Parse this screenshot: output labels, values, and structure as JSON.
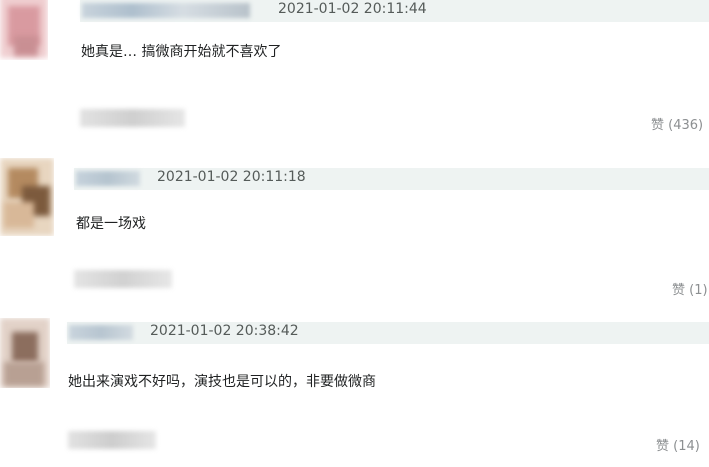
{
  "comments": [
    {
      "timestamp": "2021-01-02 20:11:44",
      "text": "她真是… 搞微商开始就不喜欢了",
      "likes": "赞 (436)"
    },
    {
      "timestamp": "2021-01-02 20:11:18",
      "text": "都是一场戏",
      "likes": "赞 (1)"
    },
    {
      "timestamp": "2021-01-02 20:38:42",
      "text": "她出来演戏不好吗，演技也是可以的，非要做微商",
      "likes": "赞 (14)"
    }
  ],
  "colors": {
    "header_bg": "#eef3f2",
    "timestamp": "#555b59",
    "text": "#1f2122",
    "likes": "#8c8f91"
  },
  "icons": {
    "avatar": "blurred-avatar",
    "username": "blurred-username"
  }
}
